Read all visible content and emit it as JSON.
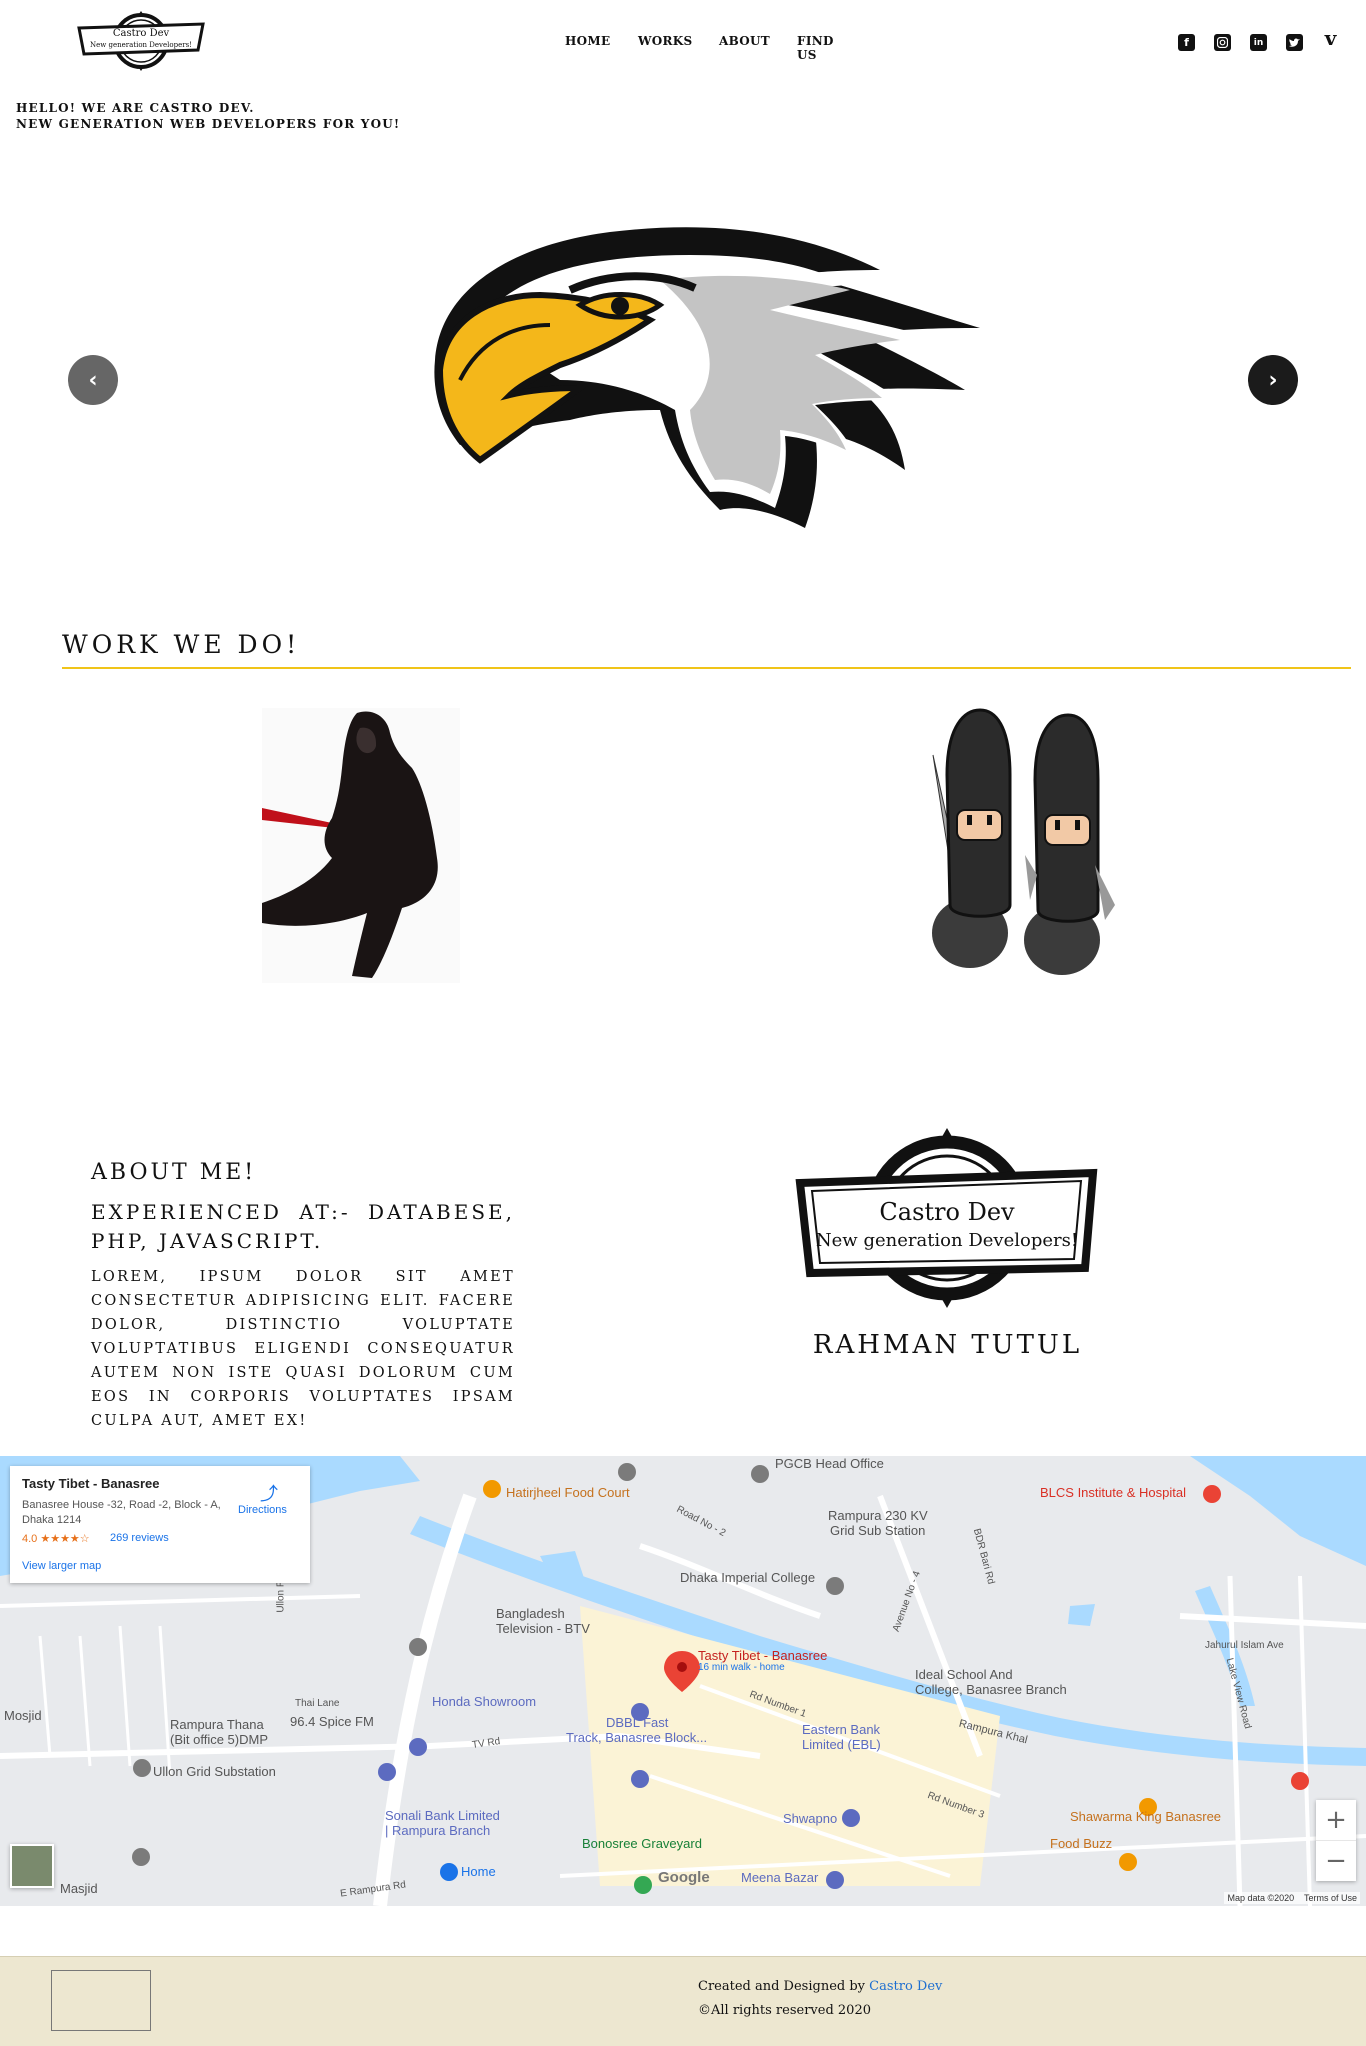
{
  "header": {
    "logo": {
      "line1": "Castro Dev",
      "line2": "New generation Developers!"
    },
    "nav": [
      "HOME",
      "WORKS",
      "ABOUT",
      "FIND US"
    ],
    "social_icons": [
      "facebook-icon",
      "instagram-icon",
      "linkedin-icon",
      "twitter-icon",
      "vimeo-icon"
    ],
    "hello_line1": "HELLO! WE ARE CASTRO DEV.",
    "hello_line2": "NEW GENERATION WEB DEVELOPERS FOR YOU!"
  },
  "carousel": {
    "prev_icon": "chevron-left-icon",
    "next_icon": "chevron-right-icon",
    "colors": {
      "beak": "#f4b71a",
      "feather_gray": "#c4c4c4",
      "outline": "#111111"
    }
  },
  "work": {
    "title": "WORK WE DO!",
    "accent": "#f0c419"
  },
  "about": {
    "heading": "ABOUT ME!",
    "experience": "EXPERIENCED AT:- DATABESE, PHP, JAVASCRIPT.",
    "paragraph": "LOREM, IPSUM DOLOR SIT AMET CONSECTETUR ADIPISICING ELIT. FACERE DOLOR, DISTINCTIO VOLUPTATE VOLUPTATIBUS ELIGENDI CONSEQUATUR AUTEM NON ISTE QUASI DOLORUM CUM EOS IN CORPORIS VOLUPTATES IPSAM CULPA AUT, AMET EX!",
    "logo": {
      "line1": "Castro Dev",
      "line2": "New generation Developers!"
    },
    "owner": "RAHMAN TUTUL"
  },
  "map": {
    "place_title": "Tasty Tibet - Banasree",
    "address": "Banasree House -32, Road -2, Block - A, Dhaka 1214",
    "rating": "4.0 ★★★★☆",
    "reviews": "269 reviews",
    "larger_map": "View larger map",
    "directions": "Directions",
    "labels": {
      "hatirjheel": "Hatirjheel Food Court",
      "pgcb": "PGCB Head Office",
      "rampura230": "Rampura 230 KV",
      "grid": "Grid Sub Station",
      "imperial": "Dhaka Imperial College",
      "blcs": "BLCS Institute & Hospital",
      "btv1": "Bangladesh",
      "btv2": "Television - BTV",
      "tasty": "Tasty Tibet - Banasree",
      "walk": "16 min walk - home",
      "ideal1": "Ideal School And",
      "ideal2": "College, Banasree Branch",
      "honda": "Honda Showroom",
      "spice": "96.4 Spice FM",
      "thana1": "Rampura Thana",
      "thana2": "(Bit office 5)DMP",
      "dbbl1": "DBBL Fast",
      "dbbl2": "Track, Banasree Block...",
      "ebl1": "Eastern Bank",
      "ebl2": "Limited (EBL)",
      "ullon": "Ullon Grid Substation",
      "sonali1": "Sonali Bank Limited",
      "sonali2": "| Rampura Branch",
      "shawarma": "Shawarma King Banasree",
      "foodbuzz": "Food Buzz",
      "shwapno": "Shwapno",
      "graveyard": "Bonosree Graveyard",
      "home": "Home",
      "meena": "Meena Bazar",
      "mosjid": "Mosjid",
      "masjid": "Masjid",
      "khal": "Rampura Khal",
      "road1": "Rd Number 1",
      "road3": "Rd Number 3",
      "road2": "Road No - 2",
      "avenue": "Avenue No - 4",
      "bdrbari": "BDR Bari Rd",
      "lakeview": "Lake View Road",
      "jahurul": "Jahurul Islam Ave",
      "tvrd": "TV Rd",
      "thailane": "Thai Lane",
      "ullonrd": "Ullon Rd",
      "erampura": "E Rampura Rd"
    },
    "google": "Google",
    "map_data": "Map data ©2020",
    "terms": "Terms of Use",
    "zoom_in": "+",
    "zoom_out": "−"
  },
  "footer": {
    "created_prefix": "Created and Designed by ",
    "brand": "Castro Dev",
    "rights": "©All rights reserved 2020"
  }
}
